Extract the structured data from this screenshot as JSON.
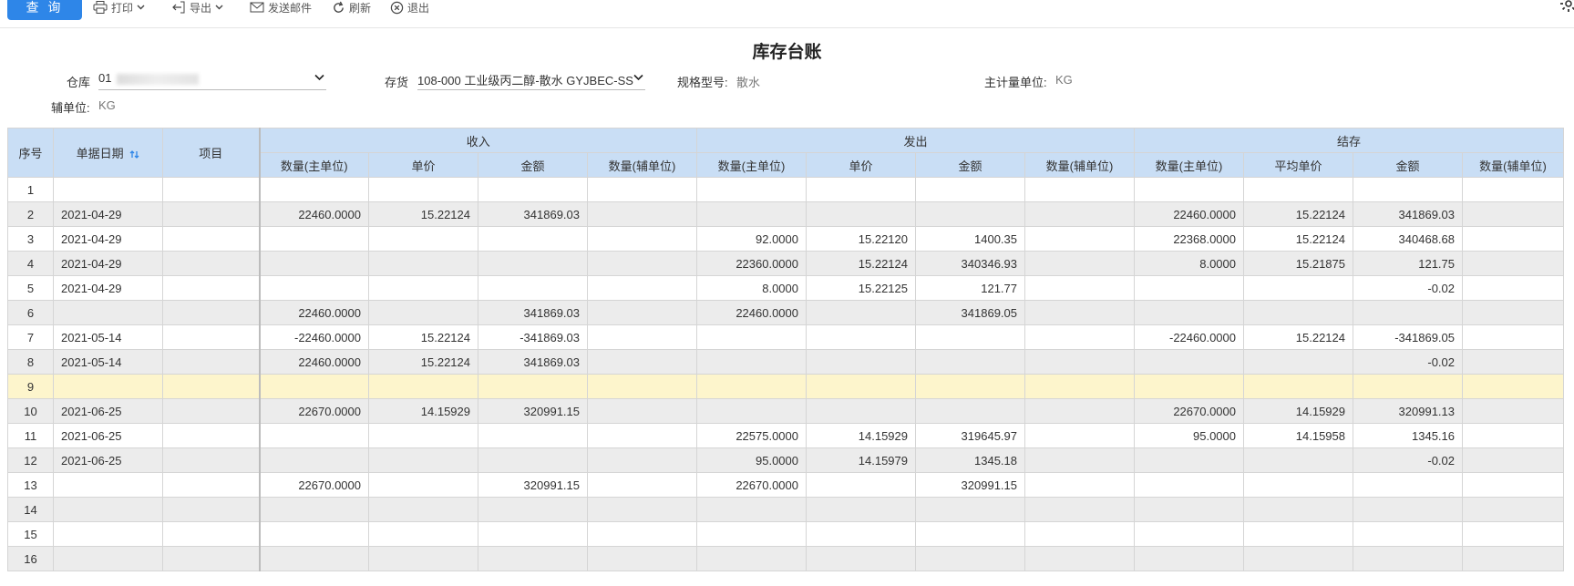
{
  "toolbar": {
    "query": "查 询",
    "print": "打印",
    "export": "导出",
    "send_mail": "发送邮件",
    "refresh": "刷新",
    "logout": "退出"
  },
  "title": "库存台账",
  "filters": {
    "warehouse_label": "仓库",
    "warehouse_value": "01",
    "stock_label": "存货",
    "stock_value": "108-000 工业级丙二醇-散水 GYJBEC-SS",
    "spec_label": "规格型号:",
    "spec_value": "散水",
    "main_unit_label": "主计量单位:",
    "main_unit_value": "KG",
    "aux_unit_label": "辅单位:",
    "aux_unit_value": "KG"
  },
  "table": {
    "h_seq": "序号",
    "h_date": "单据日期",
    "h_item": "项目",
    "h_income": "收入",
    "h_issue": "发出",
    "h_balance": "结存",
    "h_qty_main": "数量(主单位)",
    "h_price": "单价",
    "h_amount": "金额",
    "h_qty_aux": "数量(辅单位)",
    "h_avg_price": "平均单价",
    "rows": [
      [
        "1",
        "",
        "",
        "",
        "",
        "",
        "",
        "",
        "",
        "",
        "",
        "",
        "",
        "",
        ""
      ],
      [
        "2",
        "2021-04-29",
        "",
        "22460.0000",
        "15.22124",
        "341869.03",
        "",
        "",
        "",
        "",
        "",
        "22460.0000",
        "15.22124",
        "341869.03",
        ""
      ],
      [
        "3",
        "2021-04-29",
        "",
        "",
        "",
        "",
        "",
        "92.0000",
        "15.22120",
        "1400.35",
        "",
        "22368.0000",
        "15.22124",
        "340468.68",
        ""
      ],
      [
        "4",
        "2021-04-29",
        "",
        "",
        "",
        "",
        "",
        "22360.0000",
        "15.22124",
        "340346.93",
        "",
        "8.0000",
        "15.21875",
        "121.75",
        ""
      ],
      [
        "5",
        "2021-04-29",
        "",
        "",
        "",
        "",
        "",
        "8.0000",
        "15.22125",
        "121.77",
        "",
        "",
        "",
        "-0.02",
        ""
      ],
      [
        "6",
        "",
        "",
        "22460.0000",
        "",
        "341869.03",
        "",
        "22460.0000",
        "",
        "341869.05",
        "",
        "",
        "",
        "",
        ""
      ],
      [
        "7",
        "2021-05-14",
        "",
        "-22460.0000",
        "15.22124",
        "-341869.03",
        "",
        "",
        "",
        "",
        "",
        "-22460.0000",
        "15.22124",
        "-341869.05",
        ""
      ],
      [
        "8",
        "2021-05-14",
        "",
        "22460.0000",
        "15.22124",
        "341869.03",
        "",
        "",
        "",
        "",
        "",
        "",
        "",
        "-0.02",
        ""
      ],
      [
        "9",
        "",
        "",
        "",
        "",
        "",
        "",
        "",
        "",
        "",
        "",
        "",
        "",
        "",
        ""
      ],
      [
        "10",
        "2021-06-25",
        "",
        "22670.0000",
        "14.15929",
        "320991.15",
        "",
        "",
        "",
        "",
        "",
        "22670.0000",
        "14.15929",
        "320991.13",
        ""
      ],
      [
        "11",
        "2021-06-25",
        "",
        "",
        "",
        "",
        "",
        "22575.0000",
        "14.15929",
        "319645.97",
        "",
        "95.0000",
        "14.15958",
        "1345.16",
        ""
      ],
      [
        "12",
        "2021-06-25",
        "",
        "",
        "",
        "",
        "",
        "95.0000",
        "14.15979",
        "1345.18",
        "",
        "",
        "",
        "-0.02",
        ""
      ],
      [
        "13",
        "",
        "",
        "22670.0000",
        "",
        "320991.15",
        "",
        "22670.0000",
        "",
        "320991.15",
        "",
        "",
        "",
        "",
        ""
      ],
      [
        "14",
        "",
        "",
        "",
        "",
        "",
        "",
        "",
        "",
        "",
        "",
        "",
        "",
        "",
        ""
      ],
      [
        "15",
        "",
        "",
        "",
        "",
        "",
        "",
        "",
        "",
        "",
        "",
        "",
        "",
        "",
        ""
      ],
      [
        "16",
        "",
        "",
        "",
        "",
        "",
        "",
        "",
        "",
        "",
        "",
        "",
        "",
        "",
        ""
      ]
    ]
  },
  "colors": {
    "primary": "#2e86e8",
    "header_bg": "#c9def5",
    "negative": "#e52222",
    "highlight_row": "#fdf5cc"
  }
}
